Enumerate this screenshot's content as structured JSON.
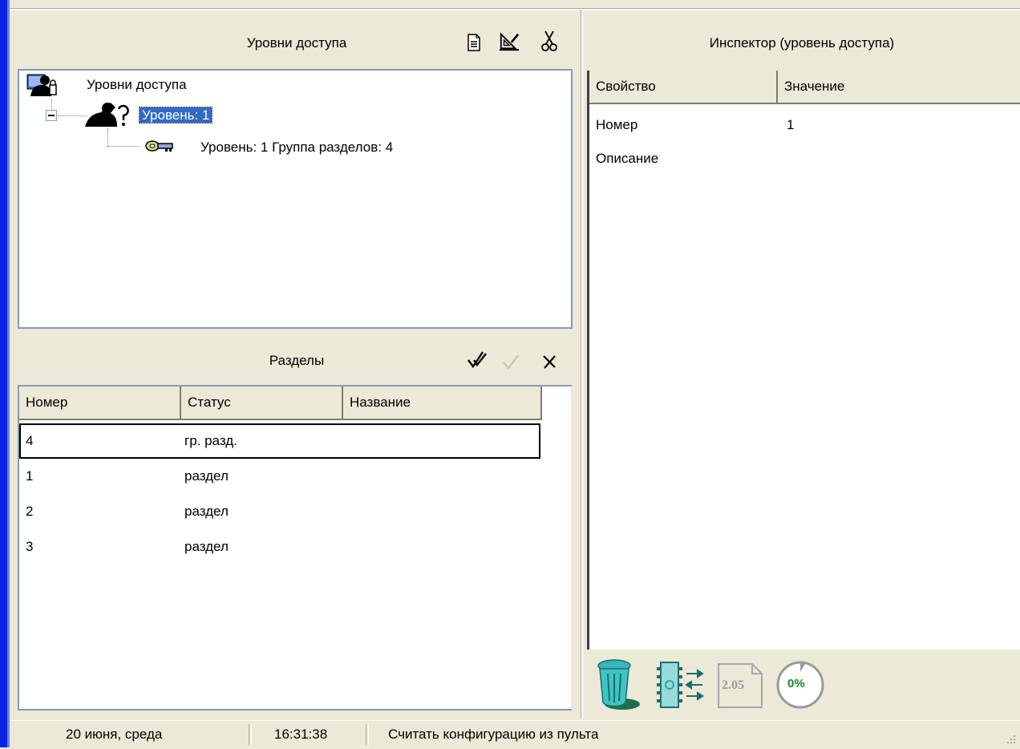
{
  "access_levels": {
    "title": "Уровни доступа",
    "toolbar": {
      "new_icon": "document-icon",
      "edit_icon": "ruler-edit-icon",
      "cut_icon": "scissors-icon"
    },
    "tree": {
      "root_label": "Уровни доступа",
      "level_label": "Уровень: 1",
      "child_label": "Уровень: 1 Группа разделов: 4"
    }
  },
  "sections": {
    "title": "Разделы",
    "toolbar": {
      "check_all_icon": "double-check-icon",
      "check_icon": "check-icon",
      "uncheck_icon": "x-icon"
    },
    "columns": [
      "Номер",
      "Статус",
      "Название"
    ],
    "rows": [
      {
        "number": "4",
        "status": "гр. разд.",
        "name": ""
      },
      {
        "number": "1",
        "status": "раздел",
        "name": ""
      },
      {
        "number": "2",
        "status": "раздел",
        "name": ""
      },
      {
        "number": "3",
        "status": "раздел",
        "name": ""
      }
    ]
  },
  "inspector": {
    "title": "Инспектор (уровень доступа)",
    "columns": [
      "Свойство",
      "Значение"
    ],
    "rows": [
      {
        "property": "Номер",
        "value": "1"
      },
      {
        "property": "Описание",
        "value": ""
      }
    ],
    "bottom_icons": [
      "trash-icon",
      "chip-transfer-icon",
      "version-icon",
      "progress-icon"
    ],
    "version_text": "2.05",
    "progress_text": "0%"
  },
  "status_bar": {
    "date": "20 июня, среда",
    "time": "16:31:38",
    "message": "Считать конфигурацию из пульта"
  },
  "colors": {
    "selection": "#316ac5",
    "window_bg": "#ece9d8",
    "left_border": "#0a24e6",
    "teal_icon": "#2aa7a7"
  }
}
